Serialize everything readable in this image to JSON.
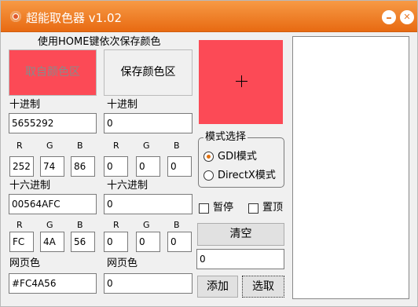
{
  "window": {
    "title": "超能取色器 v1.02",
    "minimize_glyph": "–",
    "close_glyph": "✕",
    "accent": "#F07F2A"
  },
  "hint": "使用HOME键依次保存颜色",
  "pick_zone": {
    "label": "取自颜色区",
    "color": "#FC4A56"
  },
  "save_zone": {
    "label": "保存颜色区"
  },
  "preview": {
    "color": "#FC4A56",
    "crosshair_icon": "crosshair-icon"
  },
  "left": {
    "dec_label": "十进制",
    "dec_value": "5655292",
    "r_label": "R",
    "g_label": "G",
    "b_label": "B",
    "r": "252",
    "g": "74",
    "b": "86",
    "hex_label": "十六进制",
    "hex_value": "00564AFC",
    "hr": "FC",
    "hg": "4A",
    "hb": "56",
    "web_label": "网页色",
    "web_value": "#FC4A56"
  },
  "right": {
    "dec_label": "十进制",
    "dec_value": "0",
    "r_label": "R",
    "g_label": "G",
    "b_label": "B",
    "r": "0",
    "g": "0",
    "b": "0",
    "hex_label": "十六进制",
    "hex_value": "0",
    "hr": "0",
    "hg": "0",
    "hb": "0",
    "web_label": "网页色",
    "web_value": "0"
  },
  "mode": {
    "title": "模式选择",
    "gdi": "GDI模式",
    "directx": "DirectX模式",
    "selected": "gdi"
  },
  "options": {
    "pause": "暂停",
    "topmost": "置顶"
  },
  "controls": {
    "clear": "清空",
    "count_value": "0",
    "add": "添加",
    "pick": "选取"
  }
}
